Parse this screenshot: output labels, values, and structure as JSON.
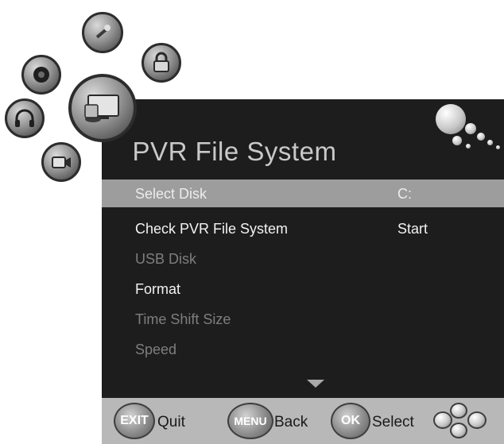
{
  "screen": {
    "title": "PVR File System"
  },
  "menu": {
    "items": [
      {
        "label": "Select Disk",
        "value": "C:",
        "state": "selected"
      },
      {
        "label": "Check PVR File System",
        "value": "Start",
        "state": "active"
      },
      {
        "label": "USB Disk",
        "value": "",
        "state": "disabled"
      },
      {
        "label": "Format",
        "value": "",
        "state": "active"
      },
      {
        "label": "Time Shift Size",
        "value": "",
        "state": "disabled"
      },
      {
        "label": "Speed",
        "value": "",
        "state": "disabled"
      }
    ],
    "more_indicator": "down-arrow-icon"
  },
  "footer": {
    "exit_key": "EXIT",
    "exit_label": "Quit",
    "menu_key": "MENU",
    "menu_label": "Back",
    "ok_key": "OK",
    "ok_label": "Select"
  },
  "nav_icons": [
    "satellite-dish-icon",
    "tools-icon",
    "lock-icon",
    "disc-icon",
    "pvr-file-system-icon",
    "headphones-icon",
    "video-camera-icon"
  ],
  "colors": {
    "panel": "#1d1d1d",
    "selected_row": "#9d9d9d",
    "footer": "#b8b8b8",
    "disabled_text": "#7e7e7e"
  }
}
